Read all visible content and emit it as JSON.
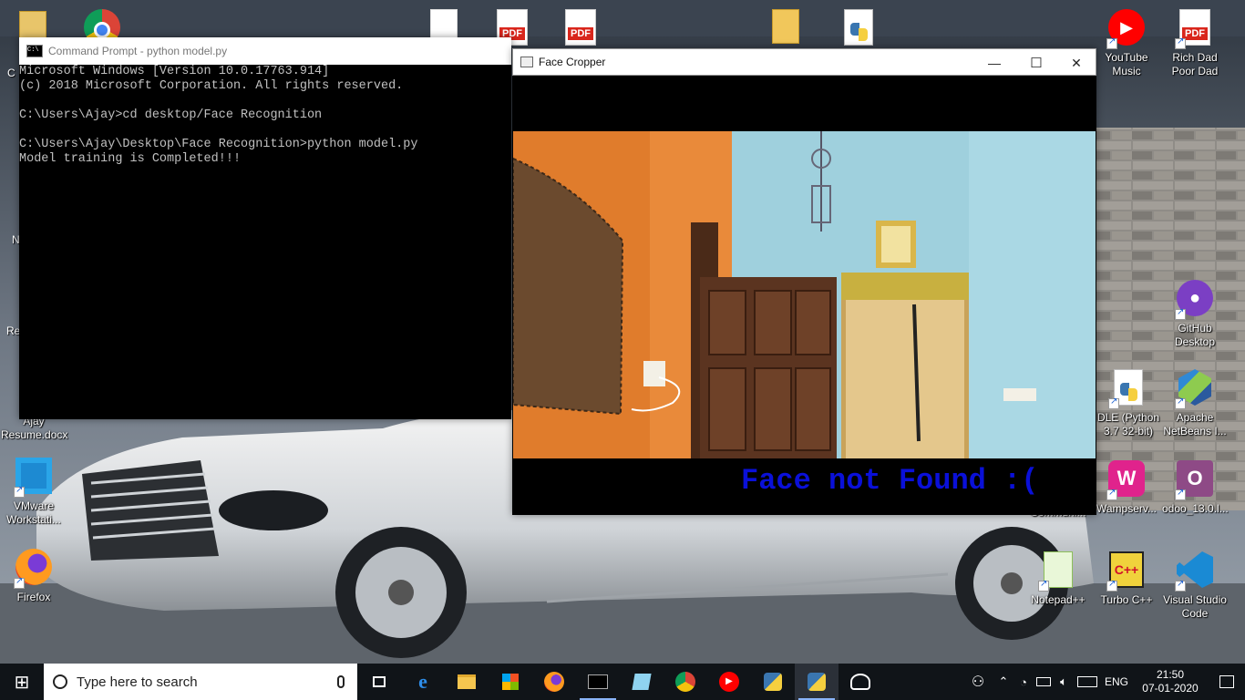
{
  "desktop": {
    "icons": [
      {
        "label": ""
      },
      {
        "label": ""
      },
      {
        "label": ""
      },
      {
        "label": ""
      },
      {
        "label": ""
      },
      {
        "label": ""
      },
      {
        "label": ""
      },
      {
        "label": "YouTube\nMusic"
      },
      {
        "label": "Rich Dad\nPoor Dad"
      },
      {
        "label": "GitHub\nDesktop"
      },
      {
        "label": "DLE (Python\n3.7 32-bit)"
      },
      {
        "label": "Apache\nNetBeans I..."
      },
      {
        "label": "Wampserv..."
      },
      {
        "label": "odoo_13.0.l..."
      },
      {
        "label": "Communi..."
      },
      {
        "label": "Notepad++"
      },
      {
        "label": "Turbo C++"
      },
      {
        "label": "Visual Studio\nCode"
      },
      {
        "label": "Ajay\nResume.docx"
      },
      {
        "label": "VMware\nWorkstati..."
      },
      {
        "label": "Firefox"
      }
    ],
    "partial_labels": [
      "C",
      "N",
      "Re"
    ]
  },
  "cmd_window": {
    "title": "Command Prompt - python  model.py",
    "icon_text": "C:\\",
    "lines": [
      "Microsoft Windows [Version 10.0.17763.914]",
      "(c) 2018 Microsoft Corporation. All rights reserved.",
      "",
      "C:\\Users\\Ajay>cd desktop/Face Recognition",
      "",
      "C:\\Users\\Ajay\\Desktop\\Face Recognition>python model.py",
      "Model training is Completed!!!"
    ]
  },
  "cropper_window": {
    "title": "Face Cropper",
    "minimize": "—",
    "maximize": "☐",
    "close": "✕",
    "status": "Face not Found :("
  },
  "taskbar": {
    "start": "⊞",
    "search_placeholder": "Type here to search",
    "language": "ENG",
    "time": "21:50",
    "date": "07-01-2020"
  },
  "colors": {
    "cmd_text": "#c0c0c0",
    "status_text": "#0a10d8",
    "taskbar": "#101418"
  }
}
